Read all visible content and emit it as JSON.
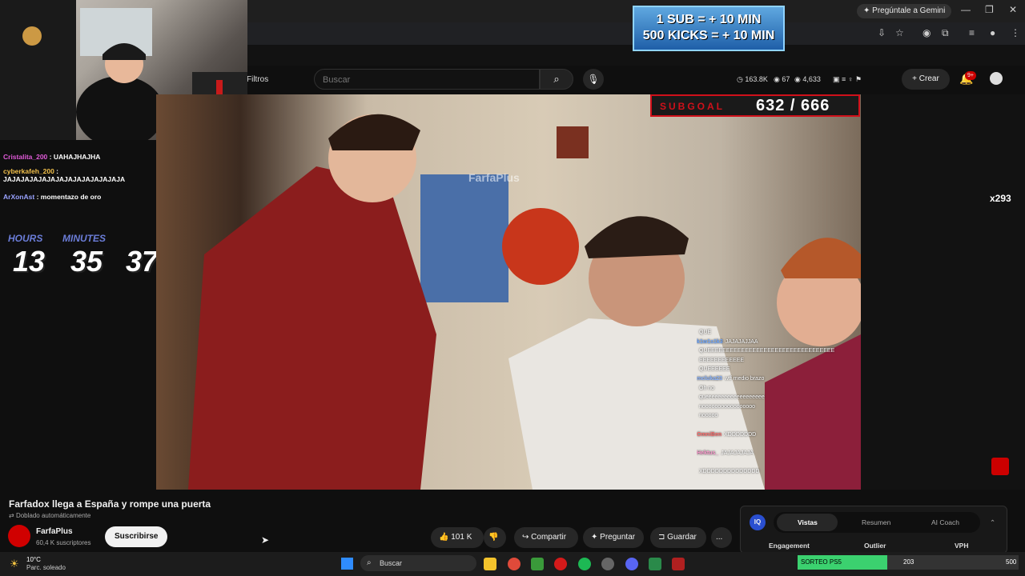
{
  "browser": {
    "gemini_label": "Pregúntale a Gemini"
  },
  "stream_overlay": {
    "sub_banner": [
      "1 SUB = + 10 MIN",
      "500 KICKS = + 10 MIN"
    ],
    "subgoal_label": "SUBGOAL",
    "subgoal_value": "632 / 666",
    "subgoal_current": 632,
    "subgoal_target": 666,
    "timer": {
      "hours_label": "HOURS",
      "minutes_label": "MINUTES",
      "hours": "13",
      "minutes": "35",
      "seconds": "37."
    },
    "kick_count": "x293",
    "left_chat": [
      {
        "user": "Cristalita_200",
        "msg": "UAHAJHAJHA",
        "color": "#e05ad8"
      },
      {
        "user": "cyberkafeh_200",
        "msg": "JAJAJAJAJAJAJAJAJAJAJAJAJAJA",
        "color": "#f2c04a"
      },
      {
        "user": "ArXonAst",
        "msg": "momentazo de oro",
        "color": "#9aa3ff"
      }
    ],
    "video_chat": [
      {
        "user": "",
        "msg": "QUE",
        "color": "#9ad"
      },
      {
        "user": "k1w1s1k3",
        "msg": "JAJAJAJJAA",
        "color": "#6fa8ff"
      },
      {
        "user": "",
        "msg": "QUEEEEEEEEEEEEEEEEEEEEEEEEEEEEEEEEEE",
        "color": "#9ad"
      },
      {
        "user": "",
        "msg": "EEEEEEEEEEEE",
        "color": "#9ad"
      },
      {
        "user": "",
        "msg": "QUEEEEEE",
        "color": "#9ad"
      },
      {
        "user": "mcluka23",
        "msg": "wtf medio brazo",
        "color": "#8ab4ff"
      },
      {
        "user": "",
        "msg": "Oh no",
        "color": "#9ad"
      },
      {
        "user": "",
        "msg": "queeeeeeeeeeeeeeeeeee",
        "color": "#9ad"
      },
      {
        "user": "",
        "msg": "nooooooooooooooooo",
        "color": "#9ad"
      },
      {
        "user": "",
        "msg": "nooooo",
        "color": "#9ad"
      },
      {
        "user": "",
        "msg": "",
        "color": "#9ad"
      },
      {
        "user": "OmniBen",
        "msg": "XDDDDDDD",
        "color": "#ff6b6b"
      },
      {
        "user": "",
        "msg": "",
        "color": "#9ad"
      },
      {
        "user": "Hektus_",
        "msg": "JAJAJAJAJA",
        "color": "#ff9bd0"
      },
      {
        "user": "",
        "msg": "",
        "color": "#9ad"
      },
      {
        "user": "",
        "msg": "XDDDDDDDDDDDDDD",
        "color": "#9ad"
      }
    ]
  },
  "youtube": {
    "filters_label": "Filtros",
    "search_placeholder": "Buscar",
    "stats": [
      "163.8K",
      "67",
      "4,633"
    ],
    "create_label": "Crear",
    "notifications_badge": "9+",
    "video_title": "Farfadox llega a España y rompe una puerta",
    "dub_label": "Doblado automáticamente",
    "channel_name": "FarfaPlus",
    "channel_subs": "60,4 K suscriptores",
    "subscribe_label": "Suscribirse",
    "likes": "101 K",
    "share_label": "Compartir",
    "ask_label": "Preguntar",
    "save_label": "Guardar",
    "more_label": "...",
    "watermark": "FarfaPlus"
  },
  "analytics": {
    "badge": "IQ",
    "tabs": [
      "Vistas",
      "Resumen",
      "AI Coach"
    ],
    "columns": [
      "Engagement",
      "Outlier",
      "VPH"
    ]
  },
  "taskbar": {
    "weather_temp": "10°C",
    "weather_desc": "Parc. soleado",
    "search_label": "Buscar",
    "giveaway_label": "SORTEO PS5",
    "giveaway_value": "203",
    "giveaway_goal": "500",
    "giveaway_progress": 0.406
  },
  "colors": {
    "accent_red": "#d0101a",
    "progress_green": "#3bd16f",
    "timer_label": "#6b7dd8"
  }
}
